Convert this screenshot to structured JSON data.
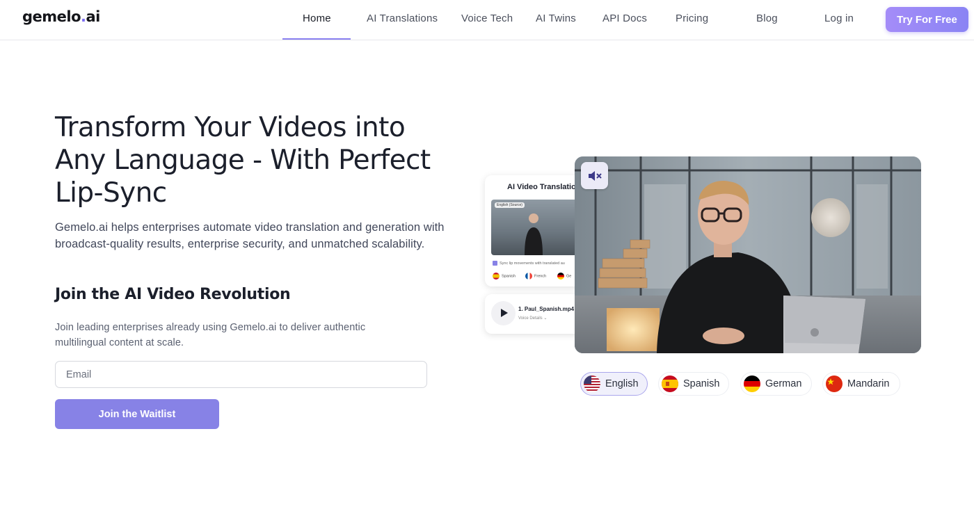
{
  "header": {
    "logo_main": "gemelo",
    "logo_dot": ".",
    "logo_suffix": "ai",
    "nav_items": [
      "Home",
      "AI Translations",
      "Voice Tech",
      "AI Twins",
      "API Docs",
      "Pricing",
      "Blog",
      "Log in"
    ],
    "active_nav": "Home",
    "cta_label": "Try For Free"
  },
  "hero": {
    "title": "Transform Your Videos into Any Language - With Perfect Lip-Sync",
    "description": "Gemelo.ai helps enterprises automate video translation and generation with broadcast-quality results, enterprise security, and unmatched scalability.",
    "join_title": "Join the AI Video Revolution",
    "join_description": "Join leading enterprises already using Gemelo.ai to deliver authentic multilingual content at scale.",
    "email_placeholder": "Email",
    "email_value": "",
    "submit_label": "Join the Waitlist"
  },
  "preview": {
    "card_title": "AI Video Translatio",
    "source_tag": "English (Source)",
    "sync_label": "Sync lip movements with translated au",
    "mini_languages": [
      "Spanish",
      "French",
      "Ge"
    ],
    "file_name": "1. Paul_Spanish.mp4",
    "file_sub": "Voice Details",
    "mute_icon": "speaker-muted-icon"
  },
  "languages": [
    {
      "label": "English",
      "flag": "us",
      "active": true
    },
    {
      "label": "Spanish",
      "flag": "es",
      "active": false
    },
    {
      "label": "German",
      "flag": "de",
      "active": false
    },
    {
      "label": "Mandarin",
      "flag": "cn",
      "active": false
    }
  ],
  "colors": {
    "accent": "#8782e6",
    "cta_gradient_start": "#a48cf8",
    "cta_gradient_end": "#8a84f4",
    "active_chip_bg": "#f0f0fb"
  }
}
